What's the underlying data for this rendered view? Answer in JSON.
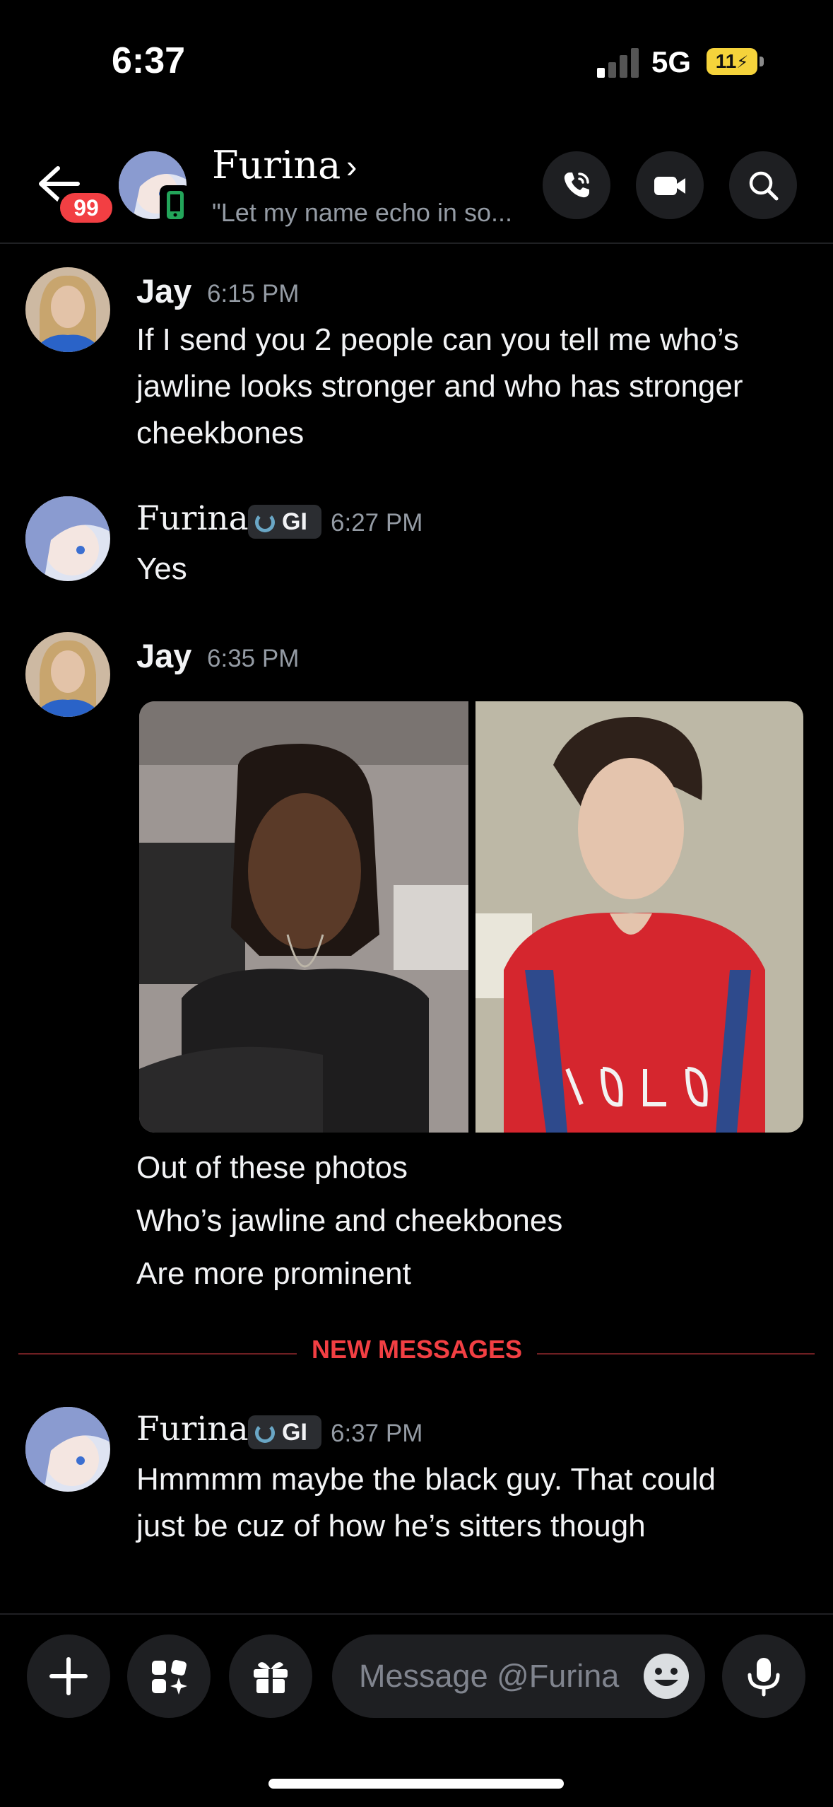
{
  "status_bar": {
    "time": "6:37",
    "network": "5G",
    "battery": "11",
    "battery_charging": true
  },
  "header": {
    "unread_badge": "99",
    "name": "Furina",
    "chevron": "›",
    "status": "\"Let my name echo in so...",
    "icons": [
      "back-arrow-icon",
      "phone-icon",
      "video-icon",
      "search-icon"
    ]
  },
  "messages": [
    {
      "author": "Jay",
      "timestamp": "6:15 PM",
      "lines": [
        "If I send you 2 people can you tell me who’s",
        "jawline looks stronger and who has stronger",
        "cheekbones"
      ]
    },
    {
      "author": "Furina",
      "tag": "GI",
      "timestamp": "6:27 PM",
      "lines": [
        "Yes"
      ]
    },
    {
      "author": "Jay",
      "timestamp": "6:35 PM",
      "lines": [
        "Out of these photos",
        "Who’s jawline and cheekbones",
        "Are more prominent"
      ]
    },
    {
      "author": "Furina",
      "tag": "GI",
      "timestamp": "6:37 PM",
      "lines": [
        "Hmmmm maybe the black guy. That could",
        "just be cuz of how he’s sitters though"
      ]
    }
  ],
  "divider": {
    "label": "NEW MESSAGES"
  },
  "composer": {
    "placeholder": "Message @Furina"
  },
  "colors": {
    "background": "#000000",
    "accent_red": "#f23f43",
    "muted": "#949ba4",
    "button_bg": "#1e1f22"
  }
}
